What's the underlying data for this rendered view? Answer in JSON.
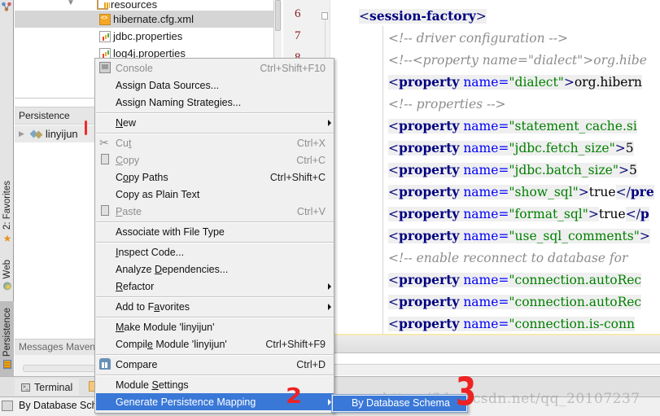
{
  "left_strip": {
    "tabs": [
      {
        "label": "2: Favorites",
        "icon": "star-icon"
      },
      {
        "label": "Web",
        "icon": "web-globe-icon"
      },
      {
        "label": "Persistence",
        "icon": "persistence-db-icon",
        "active": true
      }
    ]
  },
  "project_tree": {
    "items": [
      {
        "label": "resources",
        "icon": "resources-folder-icon",
        "expanded": true
      },
      {
        "label": "hibernate.cfg.xml",
        "icon": "xml-file-icon",
        "selected": true
      },
      {
        "label": "jdbc.properties",
        "icon": "properties-file-icon"
      },
      {
        "label": "log4j.properties",
        "icon": "properties-file-icon"
      }
    ]
  },
  "persistence_panel": {
    "title": "Persistence",
    "module": "linyijun"
  },
  "messages_panel": {
    "title": "Messages Maven"
  },
  "bottom_toolbar": {
    "terminal_label": "Terminal"
  },
  "status_bar": {
    "text": "By Database Sch"
  },
  "editor": {
    "line_numbers": [
      "6",
      "7",
      "8"
    ],
    "lines": [
      {
        "type": "tag_open",
        "indent": 1,
        "tag": "session-factory"
      },
      {
        "type": "comment",
        "indent": 2,
        "text": "<!-- driver configuration -->"
      },
      {
        "type": "comment",
        "indent": 2,
        "text": "<!--<property name=\"dialect\">org.hibe"
      },
      {
        "type": "property",
        "indent": 2,
        "name": "dialect",
        "value": "org.hibern"
      },
      {
        "type": "comment",
        "indent": 2,
        "text": "<!-- properties -->"
      },
      {
        "type": "property",
        "indent": 2,
        "name": "statement_cache.si",
        "value": "",
        "truncated": true
      },
      {
        "type": "property",
        "indent": 2,
        "name": "jdbc.fetch_size",
        "value": "5"
      },
      {
        "type": "property",
        "indent": 2,
        "name": "jdbc.batch_size",
        "value": "5"
      },
      {
        "type": "property",
        "indent": 2,
        "name": "show_sql",
        "value": "true",
        "close": "</pre"
      },
      {
        "type": "property",
        "indent": 2,
        "name": "format_sql",
        "value": "true",
        "close": "</p"
      },
      {
        "type": "property",
        "indent": 2,
        "name": "use_sql_comments",
        "value": ""
      },
      {
        "type": "comment",
        "indent": 2,
        "text": "<!-- enable reconnect to database for"
      },
      {
        "type": "property",
        "indent": 2,
        "name": "connection.autoRec",
        "value": "",
        "truncated": true
      },
      {
        "type": "property",
        "indent": 2,
        "name": "connection.autoRec",
        "value": "",
        "truncated": true
      },
      {
        "type": "property",
        "indent": 2,
        "name": "connection.is-conn",
        "value": "",
        "truncated": true
      }
    ]
  },
  "context_menu": {
    "items": [
      {
        "label": "Console",
        "shortcut": "Ctrl+Shift+F10",
        "disabled": true,
        "icon": "console-icon"
      },
      {
        "label": "Assign Data Sources...",
        "shortcut": ""
      },
      {
        "label": "Assign Naming Strategies...",
        "shortcut": ""
      },
      {
        "separator": true
      },
      {
        "label": "New",
        "mnemonic": "N",
        "submenu": true
      },
      {
        "separator": true
      },
      {
        "label": "Cut",
        "mnemonic": "t",
        "shortcut": "Ctrl+X",
        "disabled": true,
        "icon": "cut-icon"
      },
      {
        "label": "Copy",
        "mnemonic": "C",
        "shortcut": "Ctrl+C",
        "disabled": true,
        "icon": "copy-icon"
      },
      {
        "label": "Copy Paths",
        "mnemonic": "o",
        "shortcut": "Ctrl+Shift+C"
      },
      {
        "label": "Copy as Plain Text",
        "shortcut": ""
      },
      {
        "label": "Paste",
        "mnemonic": "P",
        "shortcut": "Ctrl+V",
        "disabled": true,
        "icon": "paste-icon"
      },
      {
        "separator": true
      },
      {
        "label": "Associate with File Type",
        "shortcut": ""
      },
      {
        "separator": true
      },
      {
        "label": "Inspect Code...",
        "mnemonic": "I"
      },
      {
        "label": "Analyze Dependencies...",
        "mnemonic": "D"
      },
      {
        "label": "Refactor",
        "mnemonic": "R",
        "submenu": true
      },
      {
        "separator": true
      },
      {
        "label": "Add to Favorites",
        "mnemonic": "a",
        "submenu": true
      },
      {
        "separator": true
      },
      {
        "label": "Make Module 'linyijun'",
        "mnemonic": "M"
      },
      {
        "label": "Compile Module 'linyijun'",
        "mnemonic": "e",
        "shortcut": "Ctrl+Shift+F9"
      },
      {
        "separator": true
      },
      {
        "label": "Compare",
        "shortcut": "Ctrl+D",
        "icon": "compare-icon"
      },
      {
        "separator": true
      },
      {
        "label": "Module Settings",
        "mnemonic": "S"
      },
      {
        "label": "Generate Persistence Mapping",
        "submenu": true,
        "highlighted": true
      }
    ]
  },
  "submenu": {
    "label": "By Database Schema"
  },
  "annotations": {
    "step1": "1",
    "step2": "2",
    "step3": "3"
  },
  "watermark": "https://blog.csdn.net/qq_20107237",
  "colors": {
    "menu_highlight": "#3a78d8",
    "annotation_red": "#ee2222",
    "xml_tag": "#000080",
    "xml_attr_name": "#0000ff",
    "xml_attr_value": "#008000",
    "xml_comment": "#8c8c8c",
    "line_number": "#8b1a1a"
  }
}
